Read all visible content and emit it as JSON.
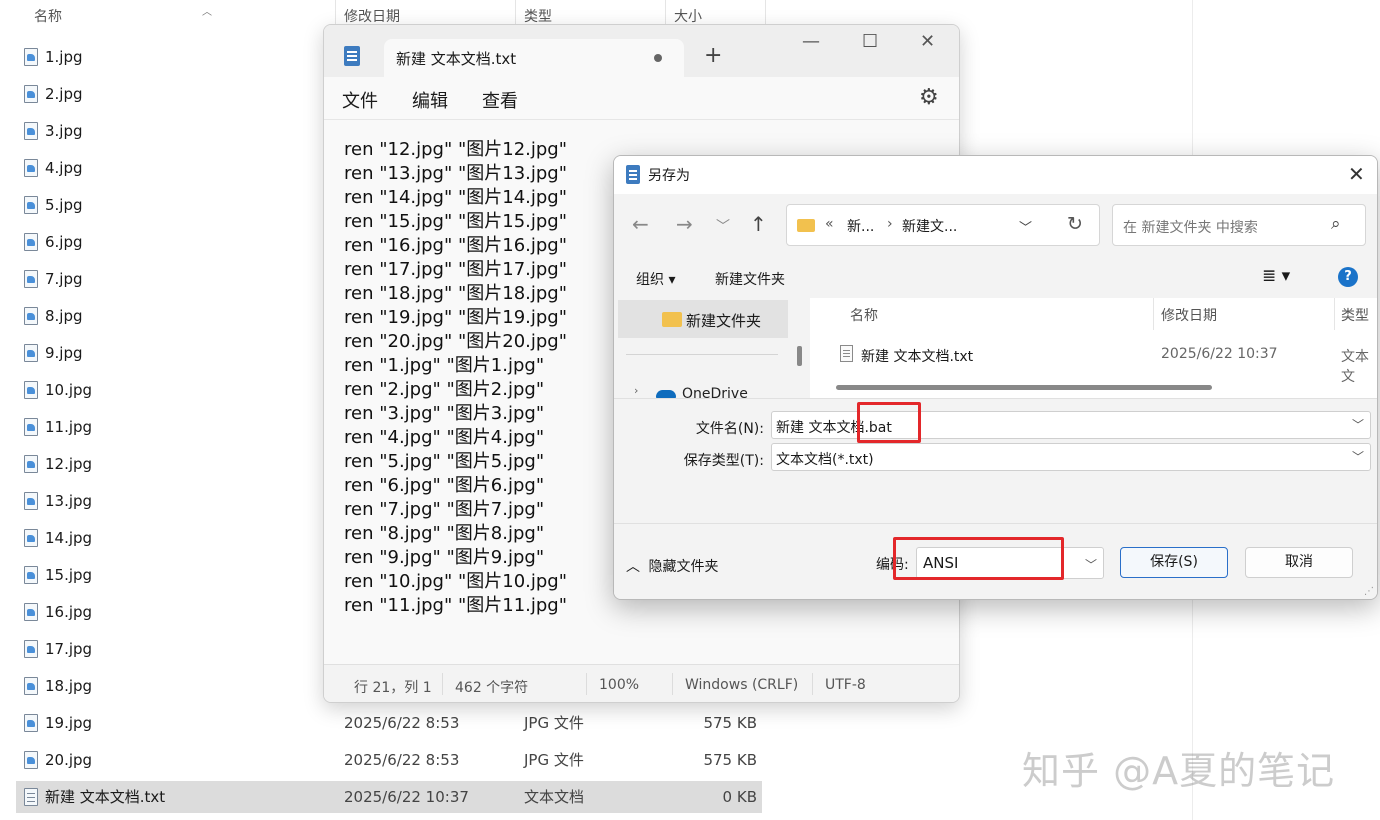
{
  "explorer": {
    "headers": {
      "name": "名称",
      "date": "修改日期",
      "type": "类型",
      "size": "大小"
    },
    "files": [
      {
        "name": "1.jpg",
        "date": "",
        "type": "",
        "size": ""
      },
      {
        "name": "2.jpg",
        "date": "",
        "type": "",
        "size": ""
      },
      {
        "name": "3.jpg",
        "date": "",
        "type": "",
        "size": ""
      },
      {
        "name": "4.jpg",
        "date": "",
        "type": "",
        "size": ""
      },
      {
        "name": "5.jpg",
        "date": "",
        "type": "",
        "size": ""
      },
      {
        "name": "6.jpg",
        "date": "",
        "type": "",
        "size": ""
      },
      {
        "name": "7.jpg",
        "date": "",
        "type": "",
        "size": ""
      },
      {
        "name": "8.jpg",
        "date": "",
        "type": "",
        "size": ""
      },
      {
        "name": "9.jpg",
        "date": "",
        "type": "",
        "size": ""
      },
      {
        "name": "10.jpg",
        "date": "",
        "type": "",
        "size": ""
      },
      {
        "name": "11.jpg",
        "date": "",
        "type": "",
        "size": ""
      },
      {
        "name": "12.jpg",
        "date": "",
        "type": "",
        "size": ""
      },
      {
        "name": "13.jpg",
        "date": "",
        "type": "",
        "size": ""
      },
      {
        "name": "14.jpg",
        "date": "",
        "type": "",
        "size": ""
      },
      {
        "name": "15.jpg",
        "date": "",
        "type": "",
        "size": ""
      },
      {
        "name": "16.jpg",
        "date": "",
        "type": "",
        "size": ""
      },
      {
        "name": "17.jpg",
        "date": "",
        "type": "",
        "size": ""
      },
      {
        "name": "18.jpg",
        "date": "",
        "type": "",
        "size": ""
      },
      {
        "name": "19.jpg",
        "date": "2025/6/22 8:53",
        "type": "JPG 文件",
        "size": "575 KB"
      },
      {
        "name": "20.jpg",
        "date": "2025/6/22 8:53",
        "type": "JPG 文件",
        "size": "575 KB"
      },
      {
        "name": "新建 文本文档.txt",
        "date": "2025/6/22 10:37",
        "type": "文本文档",
        "size": "0 KB"
      }
    ]
  },
  "notepad": {
    "tab_title": "新建 文本文档.txt",
    "new_tab": "+",
    "menu": {
      "file": "文件",
      "edit": "编辑",
      "view": "查看"
    },
    "lines": [
      "ren \"12.jpg\" \"图片12.jpg\"",
      "ren \"13.jpg\" \"图片13.jpg\"",
      "ren \"14.jpg\" \"图片14.jpg\"",
      "ren \"15.jpg\" \"图片15.jpg\"",
      "ren \"16.jpg\" \"图片16.jpg\"",
      "ren \"17.jpg\" \"图片17.jpg\"",
      "ren \"18.jpg\" \"图片18.jpg\"",
      "ren \"19.jpg\" \"图片19.jpg\"",
      "ren \"20.jpg\" \"图片20.jpg\"",
      "ren \"1.jpg\" \"图片1.jpg\"",
      "ren \"2.jpg\" \"图片2.jpg\"",
      "ren \"3.jpg\" \"图片3.jpg\"",
      "ren \"4.jpg\" \"图片4.jpg\"",
      "ren \"5.jpg\" \"图片5.jpg\"",
      "ren \"6.jpg\" \"图片6.jpg\"",
      "ren \"7.jpg\" \"图片7.jpg\"",
      "ren \"8.jpg\" \"图片8.jpg\"",
      "ren \"9.jpg\" \"图片9.jpg\"",
      "ren \"10.jpg\" \"图片10.jpg\"",
      "ren \"11.jpg\" \"图片11.jpg\""
    ],
    "status": {
      "position": "行 21，列 1",
      "chars": "462 个字符",
      "zoom": "100%",
      "line_ending": "Windows (CRLF)",
      "encoding": "UTF-8"
    }
  },
  "save_dialog": {
    "title": "另存为",
    "address": {
      "sep": "«",
      "crumb1": "新...",
      "arrow": "›",
      "crumb2": "新建文..."
    },
    "search_placeholder": "在 新建文件夹 中搜索",
    "toolbar": {
      "organize": "组织 ▾",
      "new_folder": "新建文件夹",
      "help": "?"
    },
    "tree": {
      "selected_folder": "新建文件夹",
      "onedrive": "OneDrive"
    },
    "list_headers": {
      "name": "名称",
      "date": "修改日期",
      "type": "类型"
    },
    "list_row": {
      "name": "新建 文本文档.txt",
      "date": "2025/6/22 10:37",
      "type": "文本文"
    },
    "filename_label": "文件名(N):",
    "filename_value": "新建 文本文档.bat",
    "filetype_label": "保存类型(T):",
    "filetype_value": "文本文档(*.txt)",
    "hide_folders": "隐藏文件夹",
    "encoding_label": "编码:",
    "encoding_value": "ANSI",
    "save_button": "保存(S)",
    "cancel_button": "取消"
  },
  "watermark": "知乎 @A夏的笔记",
  "colors": {
    "annotation": "#e3272a",
    "accent": "#2a6fc9",
    "folder": "#f2c14e"
  }
}
